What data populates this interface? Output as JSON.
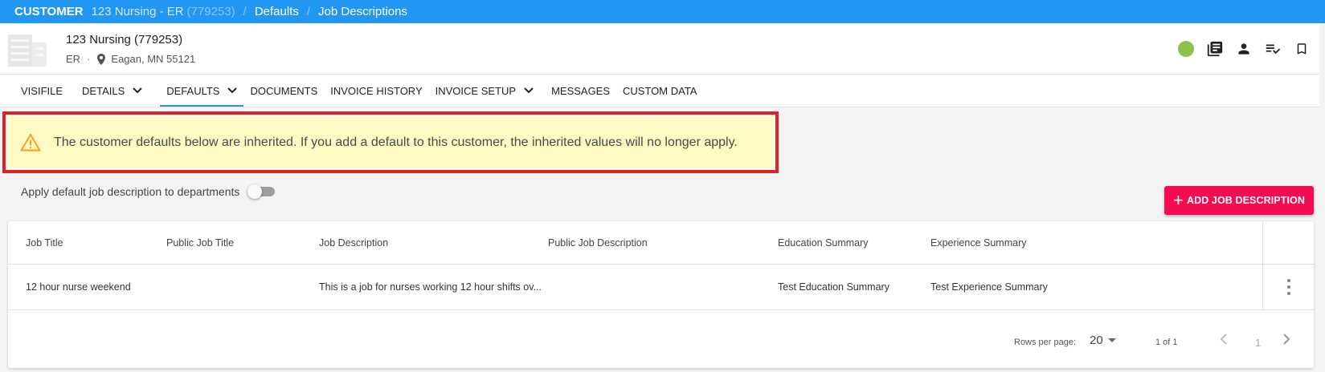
{
  "breadcrumb": {
    "root": "CUSTOMER",
    "customer": "123 Nursing - ER",
    "customer_id": "(779253)",
    "level2": "Defaults",
    "level3": "Job Descriptions",
    "separator": "/"
  },
  "header": {
    "name": "123 Nursing (779253)",
    "dept": "ER",
    "dot": "·",
    "location": "Eagan, MN 55121",
    "status_color": "#8bc34a",
    "icons": [
      "status-dot",
      "library-icon",
      "person-icon",
      "checklist-icon",
      "bookmark-icon"
    ]
  },
  "tabs": [
    {
      "label": "VISIFILE",
      "dropdown": false,
      "active": false
    },
    {
      "label": "DETAILS",
      "dropdown": true,
      "active": false
    },
    {
      "label": "DEFAULTS",
      "dropdown": true,
      "active": true
    },
    {
      "label": "DOCUMENTS",
      "dropdown": false,
      "active": false
    },
    {
      "label": "INVOICE HISTORY",
      "dropdown": false,
      "active": false
    },
    {
      "label": "INVOICE SETUP",
      "dropdown": true,
      "active": false
    },
    {
      "label": "MESSAGES",
      "dropdown": false,
      "active": false
    },
    {
      "label": "CUSTOM DATA",
      "dropdown": false,
      "active": false
    }
  ],
  "alert": {
    "message": "The customer defaults below are inherited. If you add a default to this customer, the inherited values will no longer apply."
  },
  "toggle": {
    "label": "Apply default job description to departments",
    "on": false
  },
  "add_button": {
    "label": "ADD JOB DESCRIPTION"
  },
  "table": {
    "columns": [
      "Job Title",
      "Public Job Title",
      "Job Description",
      "Public Job Description",
      "Education Summary",
      "Experience Summary"
    ],
    "rows": [
      [
        "12 hour nurse weekend",
        "",
        "This is a job for nurses working 12 hour shifts ov...",
        "",
        "Test Education Summary",
        "Test Experience Summary"
      ]
    ]
  },
  "pagination": {
    "rows_per_page_label": "Rows per page:",
    "rows_per_page": "20",
    "range": "1 of 1",
    "page": "1"
  },
  "colors": {
    "topbar": "#2196f3",
    "accent_button": "#f50b51",
    "alert_bg": "#fff9c4",
    "alert_border": "#e0202a",
    "warning_icon": "#f5a623"
  }
}
